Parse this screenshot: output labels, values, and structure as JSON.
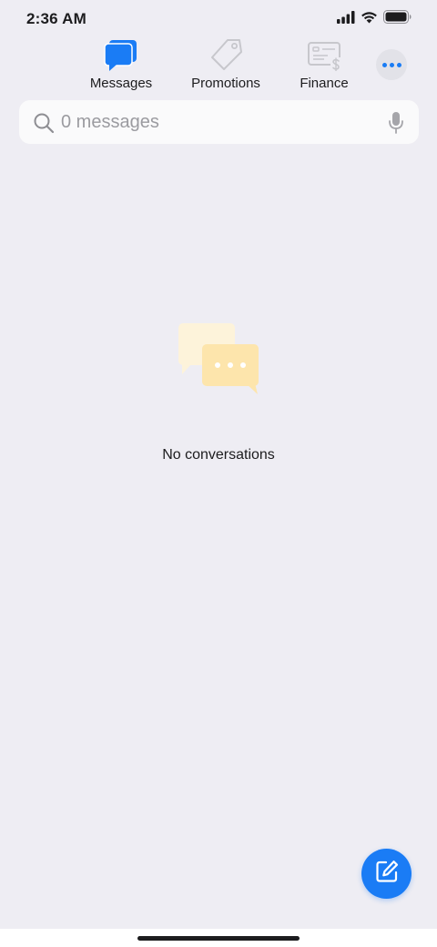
{
  "status_bar": {
    "time": "2:36 AM",
    "icons": [
      "signal-icon",
      "wifi-icon",
      "battery-icon"
    ]
  },
  "tabs": [
    {
      "label": "Messages",
      "icon": "chat-bubbles-icon",
      "active": true,
      "color": "#1a7cf5"
    },
    {
      "label": "Promotions",
      "icon": "tag-icon",
      "active": false,
      "color": "#c7c7cc"
    },
    {
      "label": "Finance",
      "icon": "bill-icon",
      "active": false,
      "color": "#c7c7cc"
    }
  ],
  "more_button": {
    "icon": "more-dots-icon"
  },
  "search": {
    "placeholder": "0 messages",
    "value": "",
    "icon": "search-icon",
    "mic_icon": "microphone-icon"
  },
  "empty_state": {
    "icon": "empty-conversations-icon",
    "text": "No conversations"
  },
  "fab": {
    "icon": "compose-icon",
    "color": "#1a7cf5"
  },
  "colors": {
    "background": "#eeedf3",
    "accent": "#1a7cf5",
    "text": "#1c1c1e",
    "placeholder": "#9b9ba0"
  }
}
